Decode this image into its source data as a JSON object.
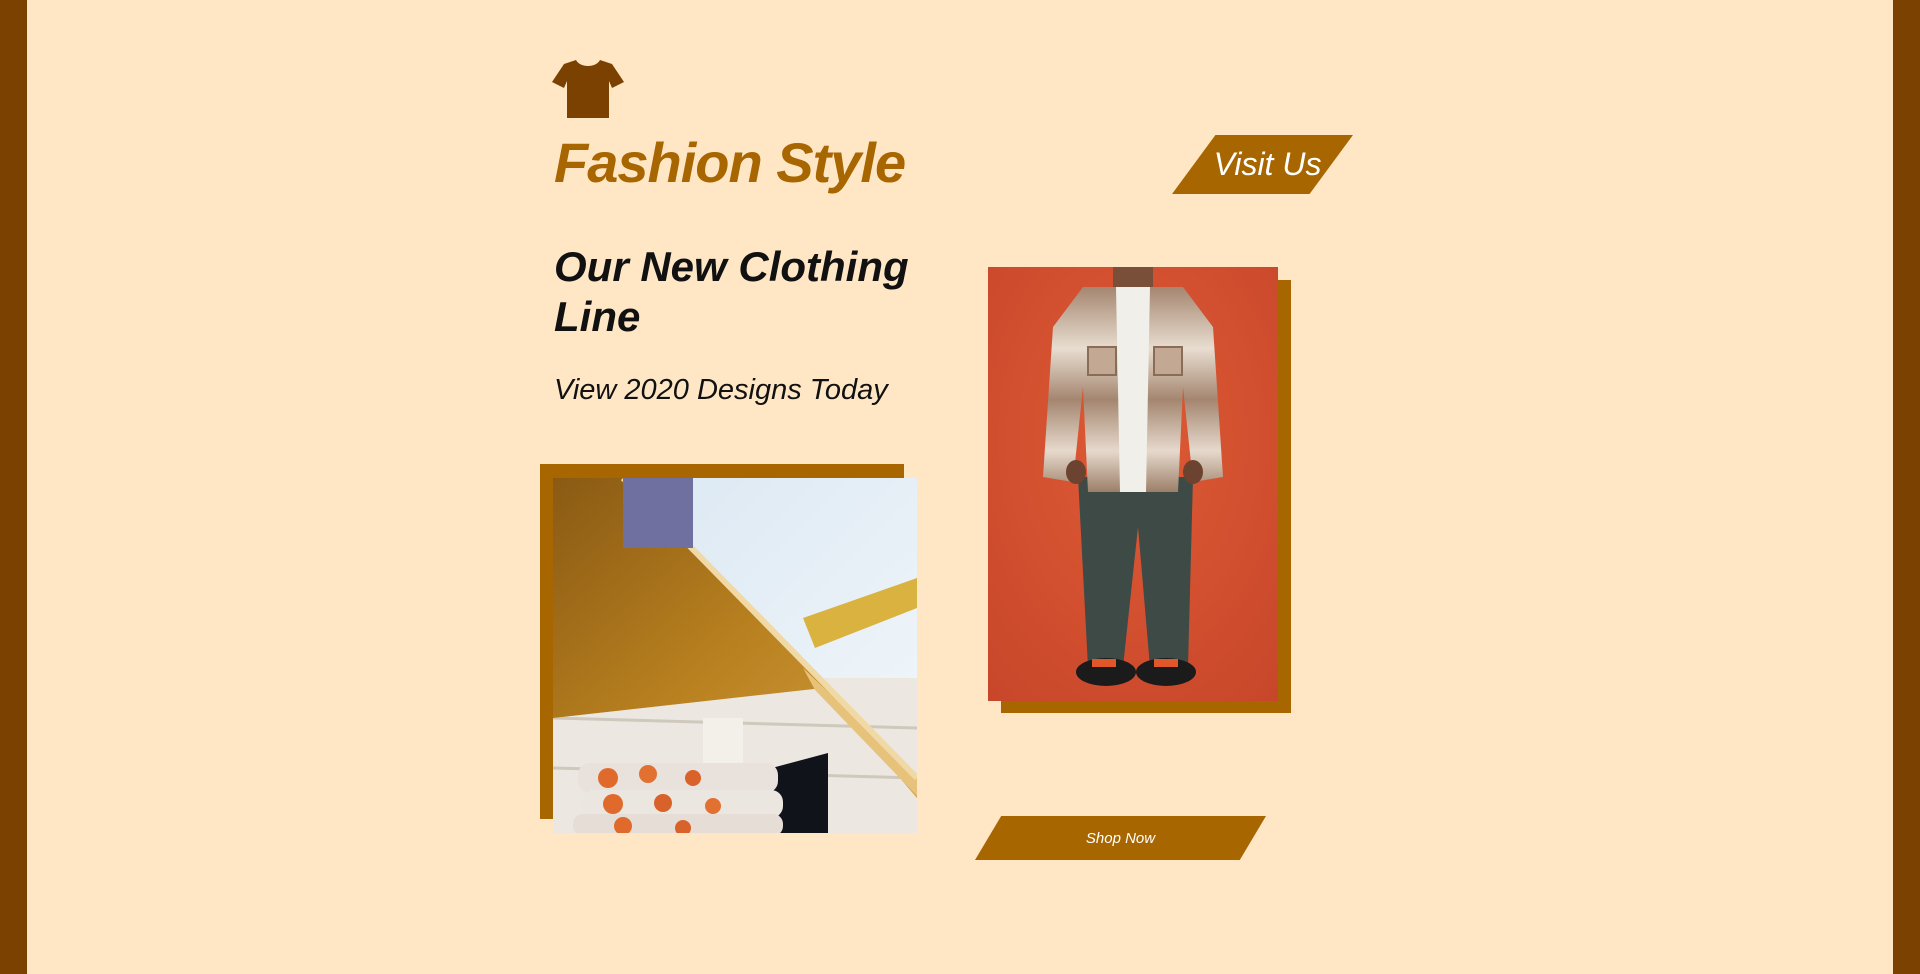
{
  "header": {
    "logo_icon": "tshirt-icon",
    "brand": "Fashion Style",
    "visit_label": "Visit Us"
  },
  "hero": {
    "headline": "Our New Clothing Line",
    "subline": "View 2020 Designs Today"
  },
  "gallery": {
    "shop_label": "Shop Now"
  },
  "colors": {
    "background": "#ffe7c6",
    "frame": "#7a4100",
    "accent": "#a86600",
    "text": "#111111"
  }
}
